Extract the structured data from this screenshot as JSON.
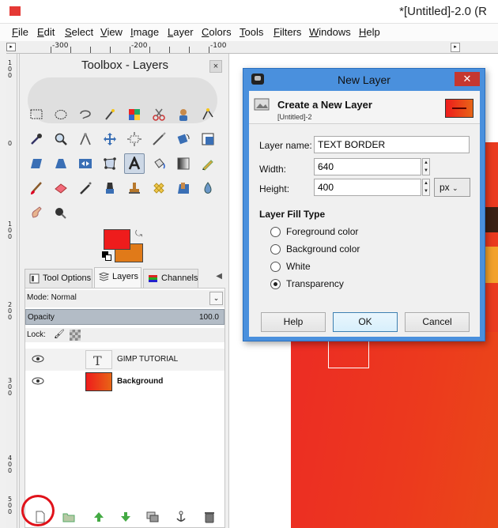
{
  "window": {
    "title": "*[Untitled]-2.0 (R",
    "app_icon": "gimp-icon"
  },
  "menu": [
    "File",
    "Edit",
    "Select",
    "View",
    "Image",
    "Layer",
    "Colors",
    "Tools",
    "Filters",
    "Windows",
    "Help"
  ],
  "ruler": {
    "h_labels": [
      "-300",
      "-200",
      "-100"
    ],
    "v_labels": [
      "100",
      "0",
      "100",
      "200",
      "300",
      "400",
      "500"
    ]
  },
  "toolbox": {
    "title": "Toolbox - Layers",
    "close_glyph": "×",
    "fg_color": "#ee1c1c",
    "bg_color": "#e07a19",
    "tabs": [
      "Tool Options",
      "Layers",
      "Channels"
    ],
    "active_tab": "Layers"
  },
  "layers": {
    "mode_label": "Mode: Normal",
    "opacity_label": "Opacity",
    "opacity_value": "100.0",
    "lock_label": "Lock:",
    "items": [
      {
        "name": "GIMP TUTORIAL",
        "type": "text",
        "visible": true,
        "selected": true
      },
      {
        "name": "Background",
        "type": "image",
        "visible": true,
        "selected": false
      }
    ],
    "toolbar_icons": [
      "new-layer-icon",
      "new-group-icon",
      "raise-layer-icon",
      "lower-layer-icon",
      "duplicate-layer-icon",
      "anchor-layer-icon",
      "delete-layer-icon"
    ]
  },
  "dialog": {
    "title": "New Layer",
    "close_glyph": "✕",
    "header_title": "Create a New Layer",
    "header_subtitle": "[Untitled]-2",
    "layer_name_label": "Layer name:",
    "layer_name_value": "TEXT BORDER",
    "width_label": "Width:",
    "width_value": "640",
    "height_label": "Height:",
    "height_value": "400",
    "unit": "px",
    "fill_type_label": "Layer Fill Type",
    "fill_options": [
      "Foreground color",
      "Background color",
      "White",
      "Transparency"
    ],
    "fill_selected": "Transparency",
    "buttons": {
      "help": "Help",
      "ok": "OK",
      "cancel": "Cancel"
    }
  }
}
